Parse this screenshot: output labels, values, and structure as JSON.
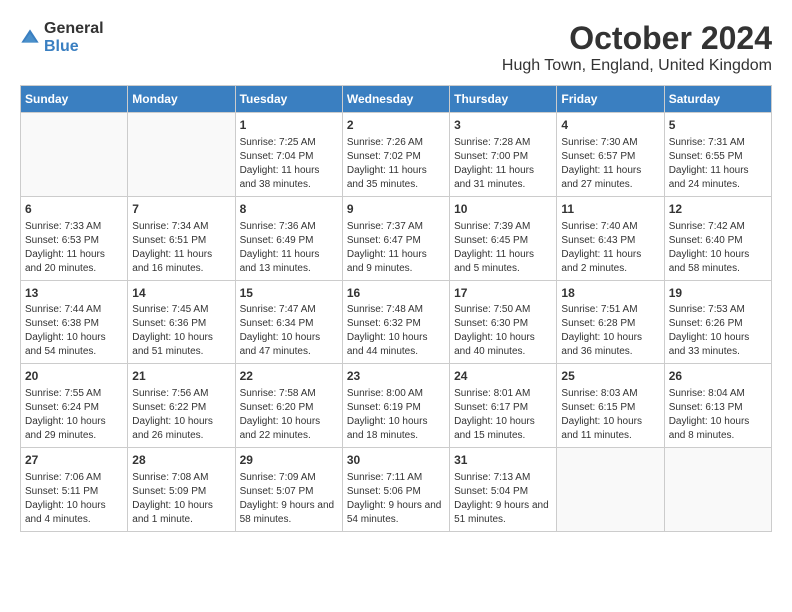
{
  "logo": {
    "general": "General",
    "blue": "Blue"
  },
  "header": {
    "month": "October 2024",
    "location": "Hugh Town, England, United Kingdom"
  },
  "weekdays": [
    "Sunday",
    "Monday",
    "Tuesday",
    "Wednesday",
    "Thursday",
    "Friday",
    "Saturday"
  ],
  "weeks": [
    [
      {
        "day": "",
        "info": ""
      },
      {
        "day": "",
        "info": ""
      },
      {
        "day": "1",
        "info": "Sunrise: 7:25 AM\nSunset: 7:04 PM\nDaylight: 11 hours and 38 minutes."
      },
      {
        "day": "2",
        "info": "Sunrise: 7:26 AM\nSunset: 7:02 PM\nDaylight: 11 hours and 35 minutes."
      },
      {
        "day": "3",
        "info": "Sunrise: 7:28 AM\nSunset: 7:00 PM\nDaylight: 11 hours and 31 minutes."
      },
      {
        "day": "4",
        "info": "Sunrise: 7:30 AM\nSunset: 6:57 PM\nDaylight: 11 hours and 27 minutes."
      },
      {
        "day": "5",
        "info": "Sunrise: 7:31 AM\nSunset: 6:55 PM\nDaylight: 11 hours and 24 minutes."
      }
    ],
    [
      {
        "day": "6",
        "info": "Sunrise: 7:33 AM\nSunset: 6:53 PM\nDaylight: 11 hours and 20 minutes."
      },
      {
        "day": "7",
        "info": "Sunrise: 7:34 AM\nSunset: 6:51 PM\nDaylight: 11 hours and 16 minutes."
      },
      {
        "day": "8",
        "info": "Sunrise: 7:36 AM\nSunset: 6:49 PM\nDaylight: 11 hours and 13 minutes."
      },
      {
        "day": "9",
        "info": "Sunrise: 7:37 AM\nSunset: 6:47 PM\nDaylight: 11 hours and 9 minutes."
      },
      {
        "day": "10",
        "info": "Sunrise: 7:39 AM\nSunset: 6:45 PM\nDaylight: 11 hours and 5 minutes."
      },
      {
        "day": "11",
        "info": "Sunrise: 7:40 AM\nSunset: 6:43 PM\nDaylight: 11 hours and 2 minutes."
      },
      {
        "day": "12",
        "info": "Sunrise: 7:42 AM\nSunset: 6:40 PM\nDaylight: 10 hours and 58 minutes."
      }
    ],
    [
      {
        "day": "13",
        "info": "Sunrise: 7:44 AM\nSunset: 6:38 PM\nDaylight: 10 hours and 54 minutes."
      },
      {
        "day": "14",
        "info": "Sunrise: 7:45 AM\nSunset: 6:36 PM\nDaylight: 10 hours and 51 minutes."
      },
      {
        "day": "15",
        "info": "Sunrise: 7:47 AM\nSunset: 6:34 PM\nDaylight: 10 hours and 47 minutes."
      },
      {
        "day": "16",
        "info": "Sunrise: 7:48 AM\nSunset: 6:32 PM\nDaylight: 10 hours and 44 minutes."
      },
      {
        "day": "17",
        "info": "Sunrise: 7:50 AM\nSunset: 6:30 PM\nDaylight: 10 hours and 40 minutes."
      },
      {
        "day": "18",
        "info": "Sunrise: 7:51 AM\nSunset: 6:28 PM\nDaylight: 10 hours and 36 minutes."
      },
      {
        "day": "19",
        "info": "Sunrise: 7:53 AM\nSunset: 6:26 PM\nDaylight: 10 hours and 33 minutes."
      }
    ],
    [
      {
        "day": "20",
        "info": "Sunrise: 7:55 AM\nSunset: 6:24 PM\nDaylight: 10 hours and 29 minutes."
      },
      {
        "day": "21",
        "info": "Sunrise: 7:56 AM\nSunset: 6:22 PM\nDaylight: 10 hours and 26 minutes."
      },
      {
        "day": "22",
        "info": "Sunrise: 7:58 AM\nSunset: 6:20 PM\nDaylight: 10 hours and 22 minutes."
      },
      {
        "day": "23",
        "info": "Sunrise: 8:00 AM\nSunset: 6:19 PM\nDaylight: 10 hours and 18 minutes."
      },
      {
        "day": "24",
        "info": "Sunrise: 8:01 AM\nSunset: 6:17 PM\nDaylight: 10 hours and 15 minutes."
      },
      {
        "day": "25",
        "info": "Sunrise: 8:03 AM\nSunset: 6:15 PM\nDaylight: 10 hours and 11 minutes."
      },
      {
        "day": "26",
        "info": "Sunrise: 8:04 AM\nSunset: 6:13 PM\nDaylight: 10 hours and 8 minutes."
      }
    ],
    [
      {
        "day": "27",
        "info": "Sunrise: 7:06 AM\nSunset: 5:11 PM\nDaylight: 10 hours and 4 minutes."
      },
      {
        "day": "28",
        "info": "Sunrise: 7:08 AM\nSunset: 5:09 PM\nDaylight: 10 hours and 1 minute."
      },
      {
        "day": "29",
        "info": "Sunrise: 7:09 AM\nSunset: 5:07 PM\nDaylight: 9 hours and 58 minutes."
      },
      {
        "day": "30",
        "info": "Sunrise: 7:11 AM\nSunset: 5:06 PM\nDaylight: 9 hours and 54 minutes."
      },
      {
        "day": "31",
        "info": "Sunrise: 7:13 AM\nSunset: 5:04 PM\nDaylight: 9 hours and 51 minutes."
      },
      {
        "day": "",
        "info": ""
      },
      {
        "day": "",
        "info": ""
      }
    ]
  ]
}
